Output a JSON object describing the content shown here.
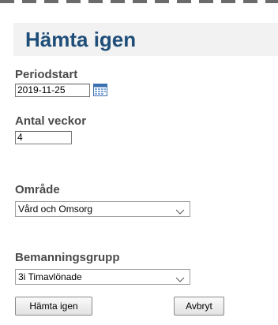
{
  "header": {
    "title": "Hämta igen"
  },
  "period_start": {
    "label": "Periodstart",
    "value": "2019-11-25",
    "icon": "calendar-icon"
  },
  "antal_veckor": {
    "label": "Antal veckor",
    "value": "4"
  },
  "omrade": {
    "label": "Område",
    "selected": "Vård och Omsorg",
    "icon": "chevron-down-icon"
  },
  "bemanningsgrupp": {
    "label": "Bemanningsgrupp",
    "selected": "3i Timavlönade",
    "icon": "chevron-down-icon"
  },
  "buttons": {
    "fetch_label": "Hämta igen",
    "cancel_label": "Avbryt"
  }
}
